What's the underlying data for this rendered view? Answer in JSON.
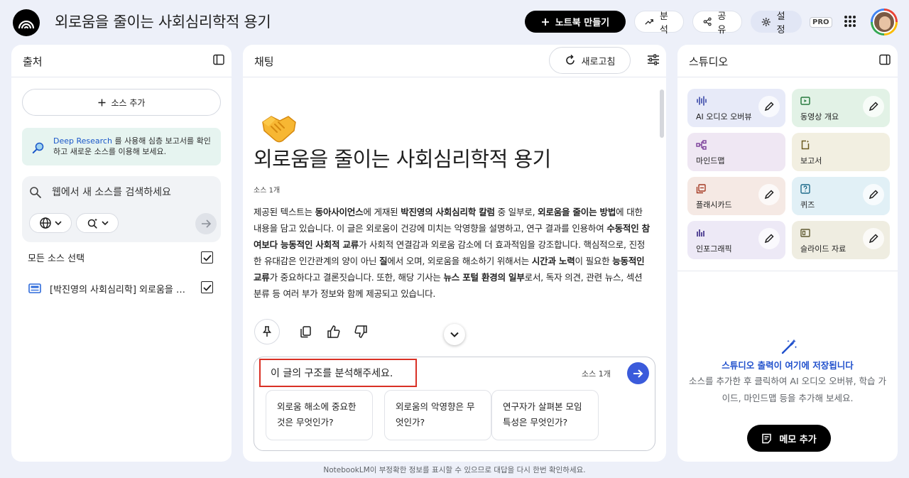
{
  "header": {
    "notebook_title": "외로움을 줄이는 사회심리학적 용기",
    "create_notebook_label": "노트북 만들기",
    "analyze_label": "분석",
    "share_label": "공유",
    "settings_label": "설정",
    "pro_badge": "PRO"
  },
  "sources_panel": {
    "title": "출처",
    "add_source_label": "소스 추가",
    "deep_research": {
      "highlight": "Deep Research",
      "text": " 를 사용해 심층 보고서를 확인하고 새로운 소스를 이용해 보세요."
    },
    "search_placeholder": "웹에서 새 소스를 검색하세요",
    "select_all_label": "모든 소스 선택",
    "sources": [
      {
        "name": "[박진영의 사회심리학] 외로움을 줄이는 사회심리학적 용기",
        "checked": true
      }
    ]
  },
  "chat_panel": {
    "title": "채팅",
    "refresh_label": "새로고침",
    "notebook_title": "외로움을 줄이는 사회심리학적 용기",
    "source_count": "소스 1개",
    "summary_parts": [
      {
        "t": "제공된 텍스트는 ",
        "b": false
      },
      {
        "t": "동아사이언스",
        "b": true
      },
      {
        "t": "에 게재된 ",
        "b": false
      },
      {
        "t": "박진영의 사회심리학 칼럼",
        "b": true
      },
      {
        "t": " 중 일부로, ",
        "b": false
      },
      {
        "t": "외로움을 줄이는 방법",
        "b": true
      },
      {
        "t": "에 대한 내용을 담고 있습니다. 이 글은 외로움이 건강에 미치는 악영향을 설명하고, 연구 결과를 인용하여 ",
        "b": false
      },
      {
        "t": "수동적인 참여보다 능동적인 사회적 교류",
        "b": true
      },
      {
        "t": "가 사회적 연결감과 외로움 감소에 더 효과적임을 강조합니다. 핵심적으로, 진정한 유대감은 인간관계의 양이 아닌 ",
        "b": false
      },
      {
        "t": "질",
        "b": true
      },
      {
        "t": "에서 오며, 외로움을 해소하기 위해서는 ",
        "b": false
      },
      {
        "t": "시간과 노력",
        "b": true
      },
      {
        "t": "이 필요한 ",
        "b": false
      },
      {
        "t": "능동적인 교류",
        "b": true
      },
      {
        "t": "가 중요하다고 결론짓습니다. 또한, 해당 기사는 ",
        "b": false
      },
      {
        "t": "뉴스 포털 환경의 일부",
        "b": true
      },
      {
        "t": "로서, 독자 의견, 관련 뉴스, 섹션 분류 등 여러 부가 정보와 함께 제공되고 있습니다.",
        "b": false
      }
    ],
    "composer_value": "이 글의 구조를 분석해주세요.",
    "composer_source_count": "소스 1개",
    "suggestions": [
      "외로움 해소에 중요한 것은 무엇인가?",
      "외로움의 악영향은 무엇인가?",
      "연구자가 살펴본 모임 특성은 무엇인가?"
    ]
  },
  "studio_panel": {
    "title": "스튜디오",
    "cards": [
      {
        "label": "AI 오디오 오버뷰",
        "icon": "audio-waveform-icon",
        "editable": true
      },
      {
        "label": "동영상 개요",
        "icon": "video-icon",
        "editable": true
      },
      {
        "label": "마인드맵",
        "icon": "mindmap-icon",
        "editable": false
      },
      {
        "label": "보고서",
        "icon": "report-icon",
        "editable": false
      },
      {
        "label": "플래시카드",
        "icon": "flashcard-icon",
        "editable": true
      },
      {
        "label": "퀴즈",
        "icon": "quiz-icon",
        "editable": true
      },
      {
        "label": "인포그래픽",
        "icon": "infographic-icon",
        "editable": true
      },
      {
        "label": "슬라이드 자료",
        "icon": "slides-icon",
        "editable": true
      }
    ],
    "empty_title": "스튜디오 출력이 여기에 저장됩니다",
    "empty_description": "소스를 추가한 후 클릭하여 AI 오디오 오버뷰, 학습 가이드, 마인드맵 등을 추가해 보세요.",
    "add_memo_label": "메모 추가"
  },
  "footer": {
    "disclaimer": "NotebookLM이 부정확한 정보를 표시할 수 있으므로 대답을 다시 한번 확인하세요."
  },
  "colors": {
    "accent_blue": "#3b5bdb",
    "page_bg": "#edf0f9",
    "highlight_red": "#d93025"
  }
}
